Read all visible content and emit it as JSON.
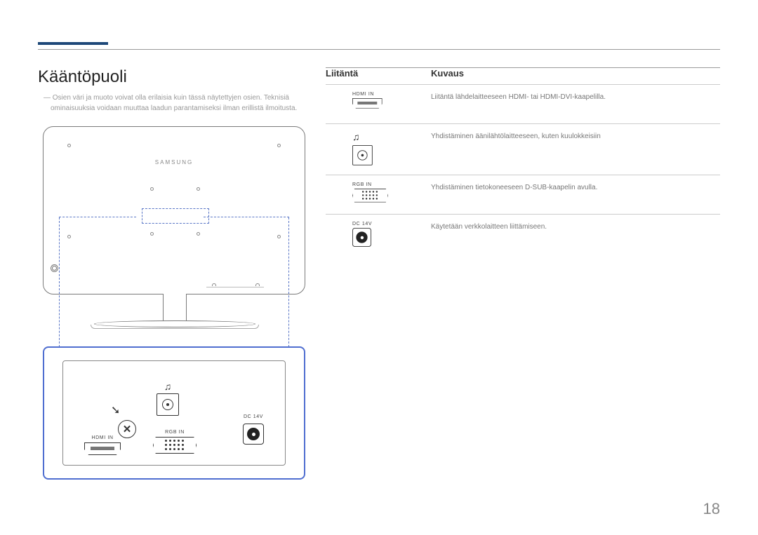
{
  "heading": "Kääntöpuoli",
  "disclaimer": "Osien väri ja muoto voivat olla erilaisia kuin tässä näytettyjen osien. Teknisiä ominaisuuksia voidaan muuttaa laadun parantamiseksi ilman erillistä ilmoitusta.",
  "brand": "SAMSUNG",
  "zoom_labels": {
    "hdmi": "HDMI IN",
    "rgb": "RGB IN",
    "dc": "DC 14V"
  },
  "table": {
    "col_port": "Liitäntä",
    "col_desc": "Kuvaus",
    "rows": [
      {
        "label": "HDMI IN",
        "icon": "hdmi",
        "desc": "Liitäntä lähdelaitteeseen HDMI- tai HDMI-DVI-kaapelilla."
      },
      {
        "label": "",
        "icon": "headphone",
        "desc": "Yhdistäminen äänilähtölaitteeseen, kuten kuulokkeisiin"
      },
      {
        "label": "RGB IN",
        "icon": "vga",
        "desc": "Yhdistäminen tietokoneeseen D-SUB-kaapelin avulla."
      },
      {
        "label": "DC 14V",
        "icon": "dc",
        "desc": "Käytetään verkkolaitteen liittämiseen."
      }
    ]
  },
  "page_number": "18"
}
